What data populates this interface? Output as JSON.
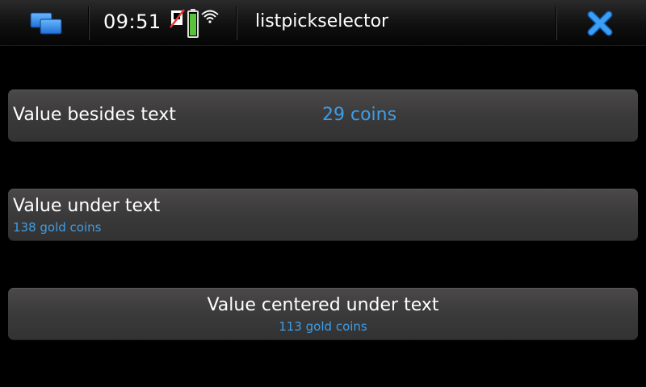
{
  "status_bar": {
    "time": "09:51",
    "app_title": "listpickselector",
    "icons": {
      "switcher": "task-switcher-icon",
      "sim": "no-sim-icon",
      "battery": "battery-icon",
      "wifi": "wifi-icon",
      "close": "close-icon"
    },
    "accent_color": "#2d8ff0"
  },
  "pickers": [
    {
      "label": "Value besides text",
      "value": "29 coins",
      "layout": "value-beside"
    },
    {
      "label": "Value under text",
      "value": "138 gold coins",
      "layout": "value-under"
    },
    {
      "label": "Value centered under text",
      "value": "113 gold coins",
      "layout": "value-centered-under"
    }
  ],
  "value_color": "#3d9ee8"
}
